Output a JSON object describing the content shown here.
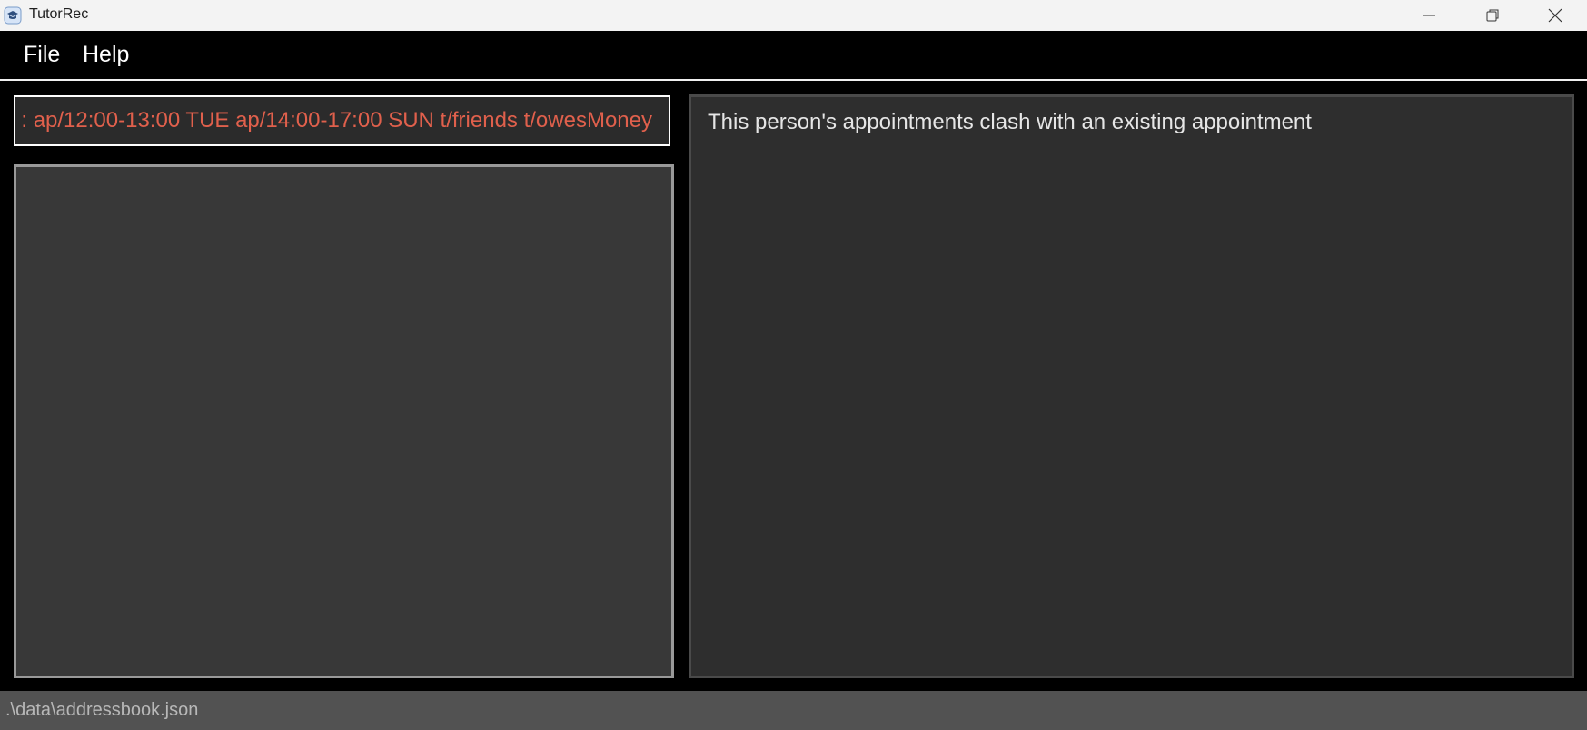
{
  "window": {
    "title": "TutorRec",
    "icon": "tutorrec-app-icon"
  },
  "menu": {
    "file_label": "File",
    "help_label": "Help"
  },
  "command_box": {
    "value": ": ap/12:00-13:00 TUE ap/14:00-17:00 SUN t/friends t/owesMoney",
    "color": "#e0604c"
  },
  "result_display": {
    "message": "This person's appointments clash with an existing appointment"
  },
  "status_bar": {
    "file_path": ".\\data\\addressbook.json"
  },
  "colors": {
    "background": "#000000",
    "panel": "#383838",
    "result_panel": "#2e2e2e",
    "status_bar": "#525252",
    "error_text": "#e0604c"
  }
}
